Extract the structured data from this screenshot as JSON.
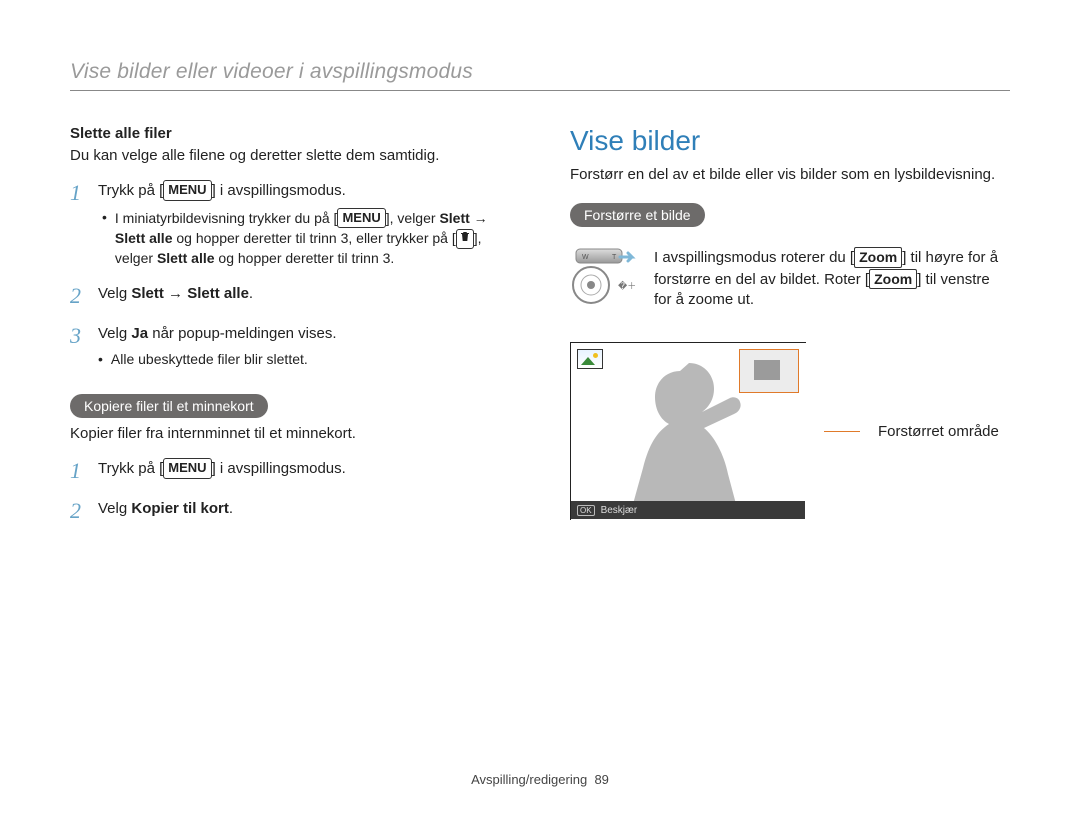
{
  "breadcrumb": "Vise bilder eller videoer i avspillingsmodus",
  "left": {
    "h_delete_all": "Slette alle filer",
    "p_delete_all": "Du kan velge alle filene og deretter slette dem samtidig.",
    "s1_pre": "Trykk på [",
    "s1_post": "] i avspillingsmodus.",
    "menu_label": "MENU",
    "s1_b_pre": "I miniatyrbildevisning trykker du på [",
    "s1_b_mid1": "], velger ",
    "s1_b_bold1": "Slett → Slett alle",
    "s1_b_mid2": " og hopper deretter til trinn 3, eller trykker på [",
    "s1_b_mid3": "], velger ",
    "s1_b_bold2": "Slett alle",
    "s1_b_mid4": " og hopper deretter til trinn 3.",
    "s2_pre": "Velg ",
    "s2_bold": "Slett → Slett alle",
    "s2_post": ".",
    "s3_pre": "Velg ",
    "s3_bold": "Ja",
    "s3_post": " når popup-meldingen vises.",
    "s3_bullet": "Alle ubeskyttede filer blir slettet.",
    "pill_copy": "Kopiere filer til et minnekort",
    "p_copy": "Kopier filer fra internminnet til et minnekort.",
    "c1_pre": "Trykk på [",
    "c1_post": "] i avspillingsmodus.",
    "c2_pre": "Velg ",
    "c2_bold": "Kopier til kort",
    "c2_post": "."
  },
  "right": {
    "title": "Vise bilder",
    "p_intro": "Forstørr en del av et bilde eller vis bilder som en lysbildevisning.",
    "pill_enlarge": "Forstørre et bilde",
    "zoom_pre": "I avspillingsmodus roterer du [",
    "zoom_b1": "Zoom",
    "zoom_mid": "] til høyre for å forstørre en del av bildet. Roter [",
    "zoom_b2": "Zoom",
    "zoom_post": "] til venstre for å zoome ut.",
    "ok_label": "OK",
    "crop_label": "Beskjær",
    "callout": "Forstørret område"
  },
  "footer_section": "Avspilling/redigering",
  "footer_page": "89"
}
